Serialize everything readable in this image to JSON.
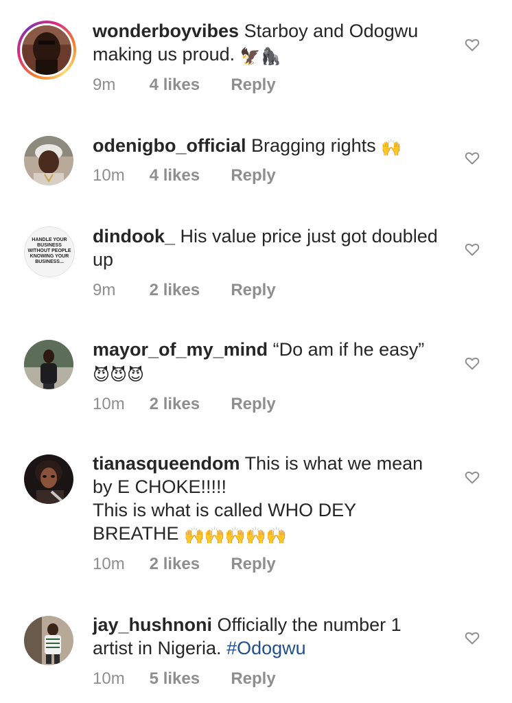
{
  "comments": [
    {
      "username": "wonderboyvibes",
      "text": "Starboy and Odogwu making us proud.",
      "emoji": "🦅🦍",
      "time": "9m",
      "likes": "4 likes",
      "reply": "Reply"
    },
    {
      "username": "odenigbo_official",
      "text": "Bragging rights",
      "emoji": "🙌",
      "time": "10m",
      "likes": "4 likes",
      "reply": "Reply"
    },
    {
      "username": "dindook_",
      "text": "His value price just got doubled up",
      "avatar_text": "HANDLE YOUR BUSINESS WITHOUT PEOPLE KNOWING YOUR BUSINESS...",
      "time": "9m",
      "likes": "2 likes",
      "reply": "Reply"
    },
    {
      "username": "mayor_of_my_mind",
      "text": "“Do am if he easy”",
      "emoji": "😈😈😈",
      "time": "10m",
      "likes": "2 likes",
      "reply": "Reply"
    },
    {
      "username": "tianasqueendom",
      "text": "This is what we mean by E CHOKE!!!!!",
      "text_line2": "This is what is called WHO DEY BREATHE",
      "emoji": "🙌🙌🙌🙌🙌",
      "time": "10m",
      "likes": "2 likes",
      "reply": "Reply"
    },
    {
      "username": "jay_hushnoni",
      "text": "Officially the number 1 artist in Nigeria.",
      "hashtag": "#Odogwu",
      "time": "10m",
      "likes": "5 likes",
      "reply": "Reply"
    }
  ],
  "icons": {
    "like": "heart-outline-icon"
  },
  "colors": {
    "text": "#262626",
    "meta": "#8e8e8e",
    "hashtag": "#1f4f8f",
    "heart_stroke": "#8e8e8e"
  }
}
